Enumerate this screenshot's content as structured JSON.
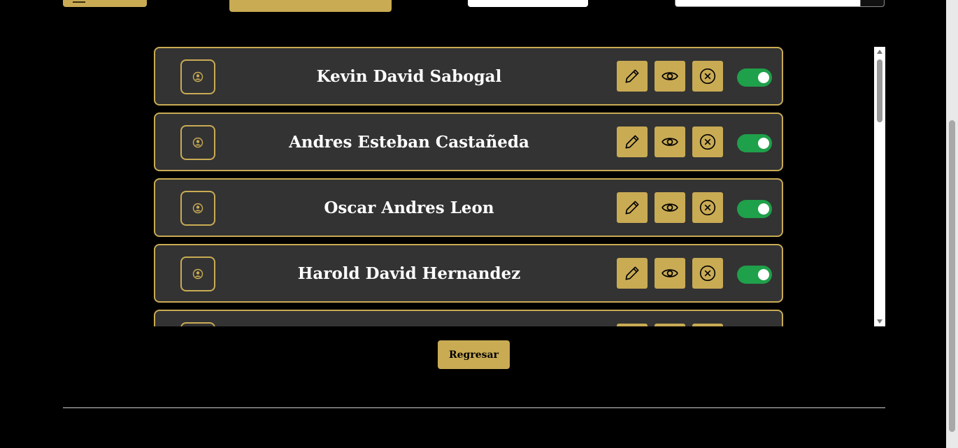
{
  "colors": {
    "accent_gold": "#c9ab54",
    "row_bg": "#333333",
    "toggle_on": "#1fa04a",
    "page_bg": "#000000"
  },
  "icons": {
    "avatar": "user-circle-icon",
    "edit": "pencil-icon",
    "view": "eye-icon",
    "delete": "x-circle-icon"
  },
  "users": [
    {
      "name": "Kevin David Sabogal",
      "active": true
    },
    {
      "name": "Andres Esteban Castañeda",
      "active": true
    },
    {
      "name": "Oscar Andres Leon",
      "active": true
    },
    {
      "name": "Harold David Hernandez",
      "active": true
    },
    {
      "name": "",
      "active": true
    }
  ],
  "actions": {
    "back_label": "Regresar"
  }
}
